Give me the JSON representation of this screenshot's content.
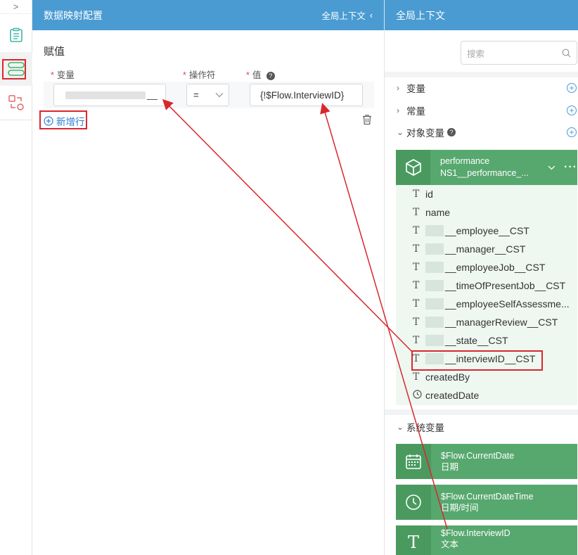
{
  "rail": {
    "collapse": ">"
  },
  "main": {
    "header_title": "数据映射配置",
    "header_right": "全局上下文",
    "section_title": "赋值",
    "columns": [
      "变量",
      "操作符",
      "值"
    ],
    "operator_value": "=",
    "value_value": "{!$Flow.InterviewID}",
    "variable_suffix": "__",
    "add_row": "新增行"
  },
  "side": {
    "header_title": "全局上下文",
    "search_placeholder": "搜索",
    "groups": [
      "变量",
      "常量",
      "对象变量"
    ],
    "object_card": {
      "name": "performance",
      "api": "NS1__performance_...",
      "more": "···"
    },
    "fields": [
      {
        "label": "id",
        "type": "text"
      },
      {
        "label": "name",
        "type": "text"
      },
      {
        "label": "__employee__CST",
        "type": "text",
        "prefix_hidden": true
      },
      {
        "label": "__manager__CST",
        "type": "text",
        "prefix_hidden": true
      },
      {
        "label": "__employeeJob__CST",
        "type": "text",
        "prefix_hidden": true
      },
      {
        "label": "__timeOfPresentJob__CST",
        "type": "text",
        "prefix_hidden": true
      },
      {
        "label": "__employeeSelfAssessme...",
        "type": "text",
        "prefix_hidden": true
      },
      {
        "label": "__managerReview__CST",
        "type": "text",
        "prefix_hidden": true
      },
      {
        "label": "__state__CST",
        "type": "text",
        "prefix_hidden": true
      },
      {
        "label": "__interviewID__CST",
        "type": "text",
        "prefix_hidden": true
      },
      {
        "label": "createdBy",
        "type": "text"
      },
      {
        "label": "createdDate",
        "type": "clock"
      }
    ],
    "system_title": "系统变量",
    "system_vars": [
      {
        "name": "$Flow.CurrentDate",
        "type": "日期",
        "icon": "calendar-icon"
      },
      {
        "name": "$Flow.CurrentDateTime",
        "type": "日期/时间",
        "icon": "clock-icon"
      },
      {
        "name": "$Flow.InterviewID",
        "type": "文本",
        "icon": "text-icon"
      }
    ]
  },
  "colors": {
    "header": "#4a9bd2",
    "card": "#57a86e",
    "annotation": "#d9272e"
  }
}
